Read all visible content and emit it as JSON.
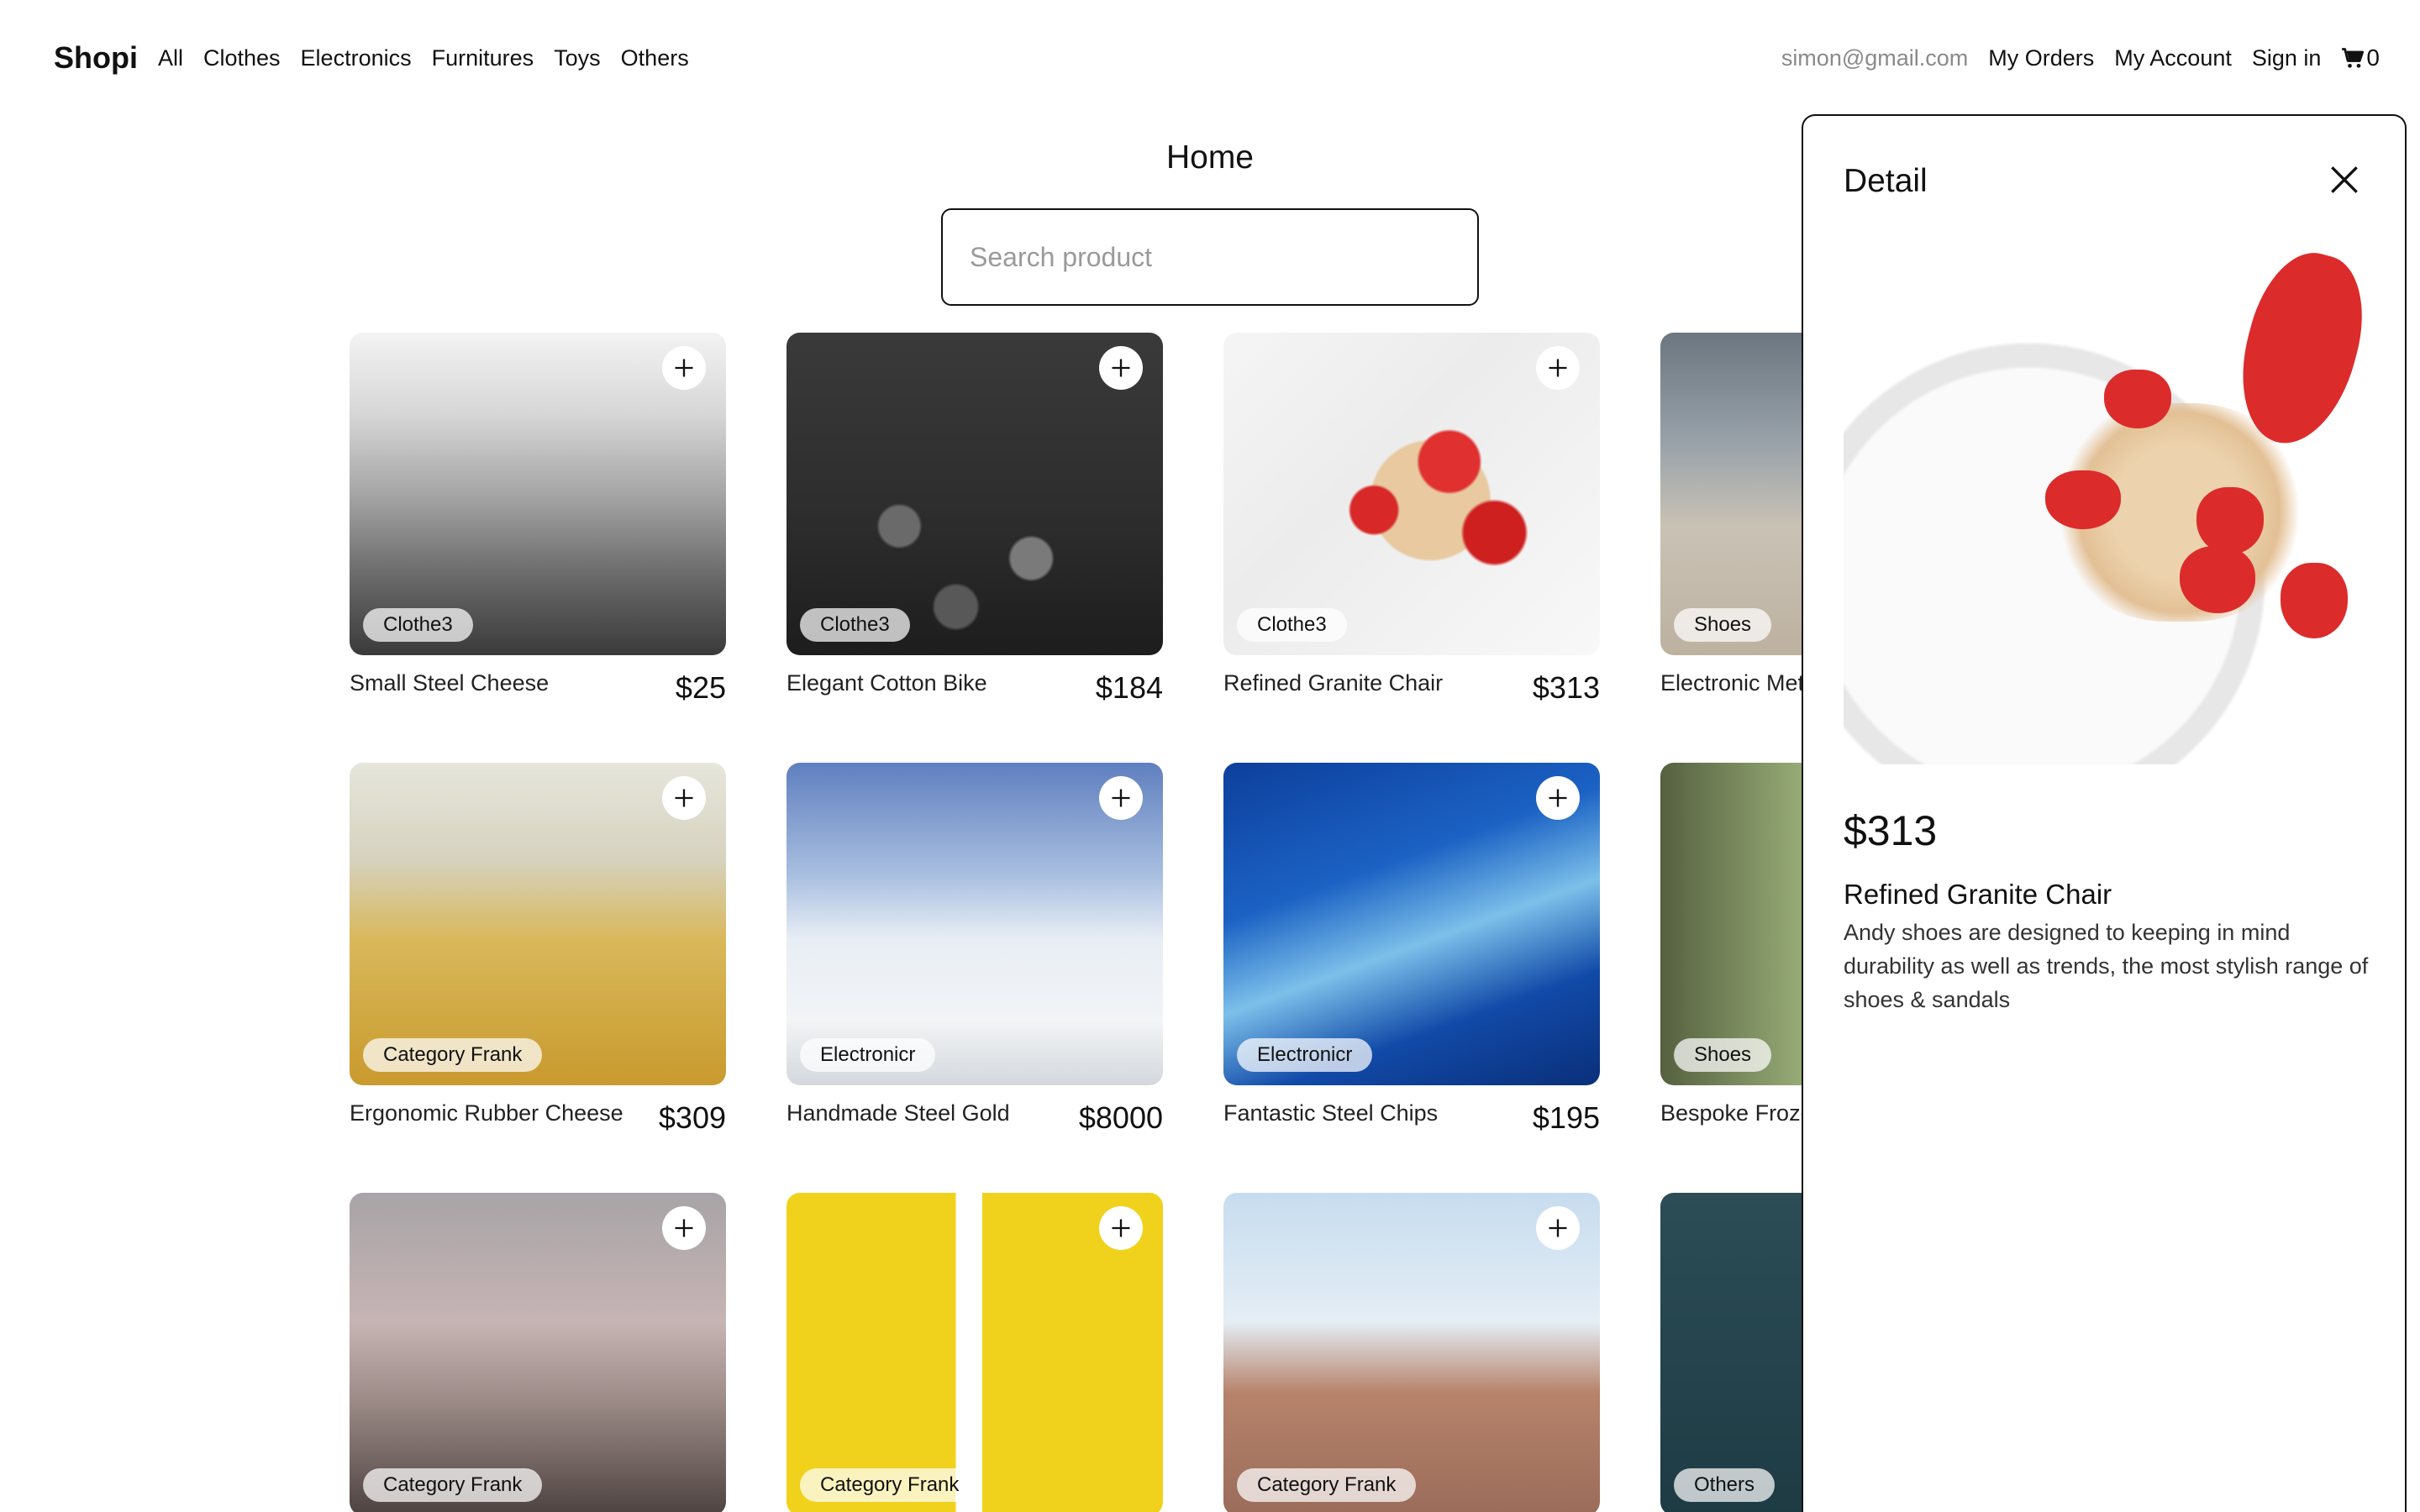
{
  "nav": {
    "brand": "Shopi",
    "links": [
      "All",
      "Clothes",
      "Electronics",
      "Furnitures",
      "Toys",
      "Others"
    ],
    "email": "simon@gmail.com",
    "my_orders": "My Orders",
    "my_account": "My Account",
    "sign_in": "Sign in",
    "cart_count": "0"
  },
  "page": {
    "title": "Home",
    "search_placeholder": "Search product"
  },
  "products": [
    {
      "name": "Small Steel Cheese",
      "price": "$25",
      "category": "Clothe3"
    },
    {
      "name": "Elegant Cotton Bike",
      "price": "$184",
      "category": "Clothe3"
    },
    {
      "name": "Refined Granite Chair",
      "price": "$313",
      "category": "Clothe3"
    },
    {
      "name": "Electronic Met",
      "price": "",
      "category": "Shoes"
    },
    {
      "name": "Ergonomic Rubber Cheese",
      "price": "$309",
      "category": "Category Frank"
    },
    {
      "name": "Handmade Steel Gold",
      "price": "$8000",
      "category": "Electronicr"
    },
    {
      "name": "Fantastic Steel Chips",
      "price": "$195",
      "category": "Electronicr"
    },
    {
      "name": "Bespoke Froze",
      "price": "",
      "category": "Shoes"
    },
    {
      "name": "",
      "price": "",
      "category": "Category Frank"
    },
    {
      "name": "",
      "price": "",
      "category": "Category Frank"
    },
    {
      "name": "",
      "price": "",
      "category": "Category Frank"
    },
    {
      "name": "",
      "price": "",
      "category": "Others"
    }
  ],
  "detail": {
    "title": "Detail",
    "price": "$313",
    "name": "Refined Granite Chair",
    "description": "Andy shoes are designed to keeping in mind durability as well as trends, the most stylish range of shoes & sandals"
  }
}
